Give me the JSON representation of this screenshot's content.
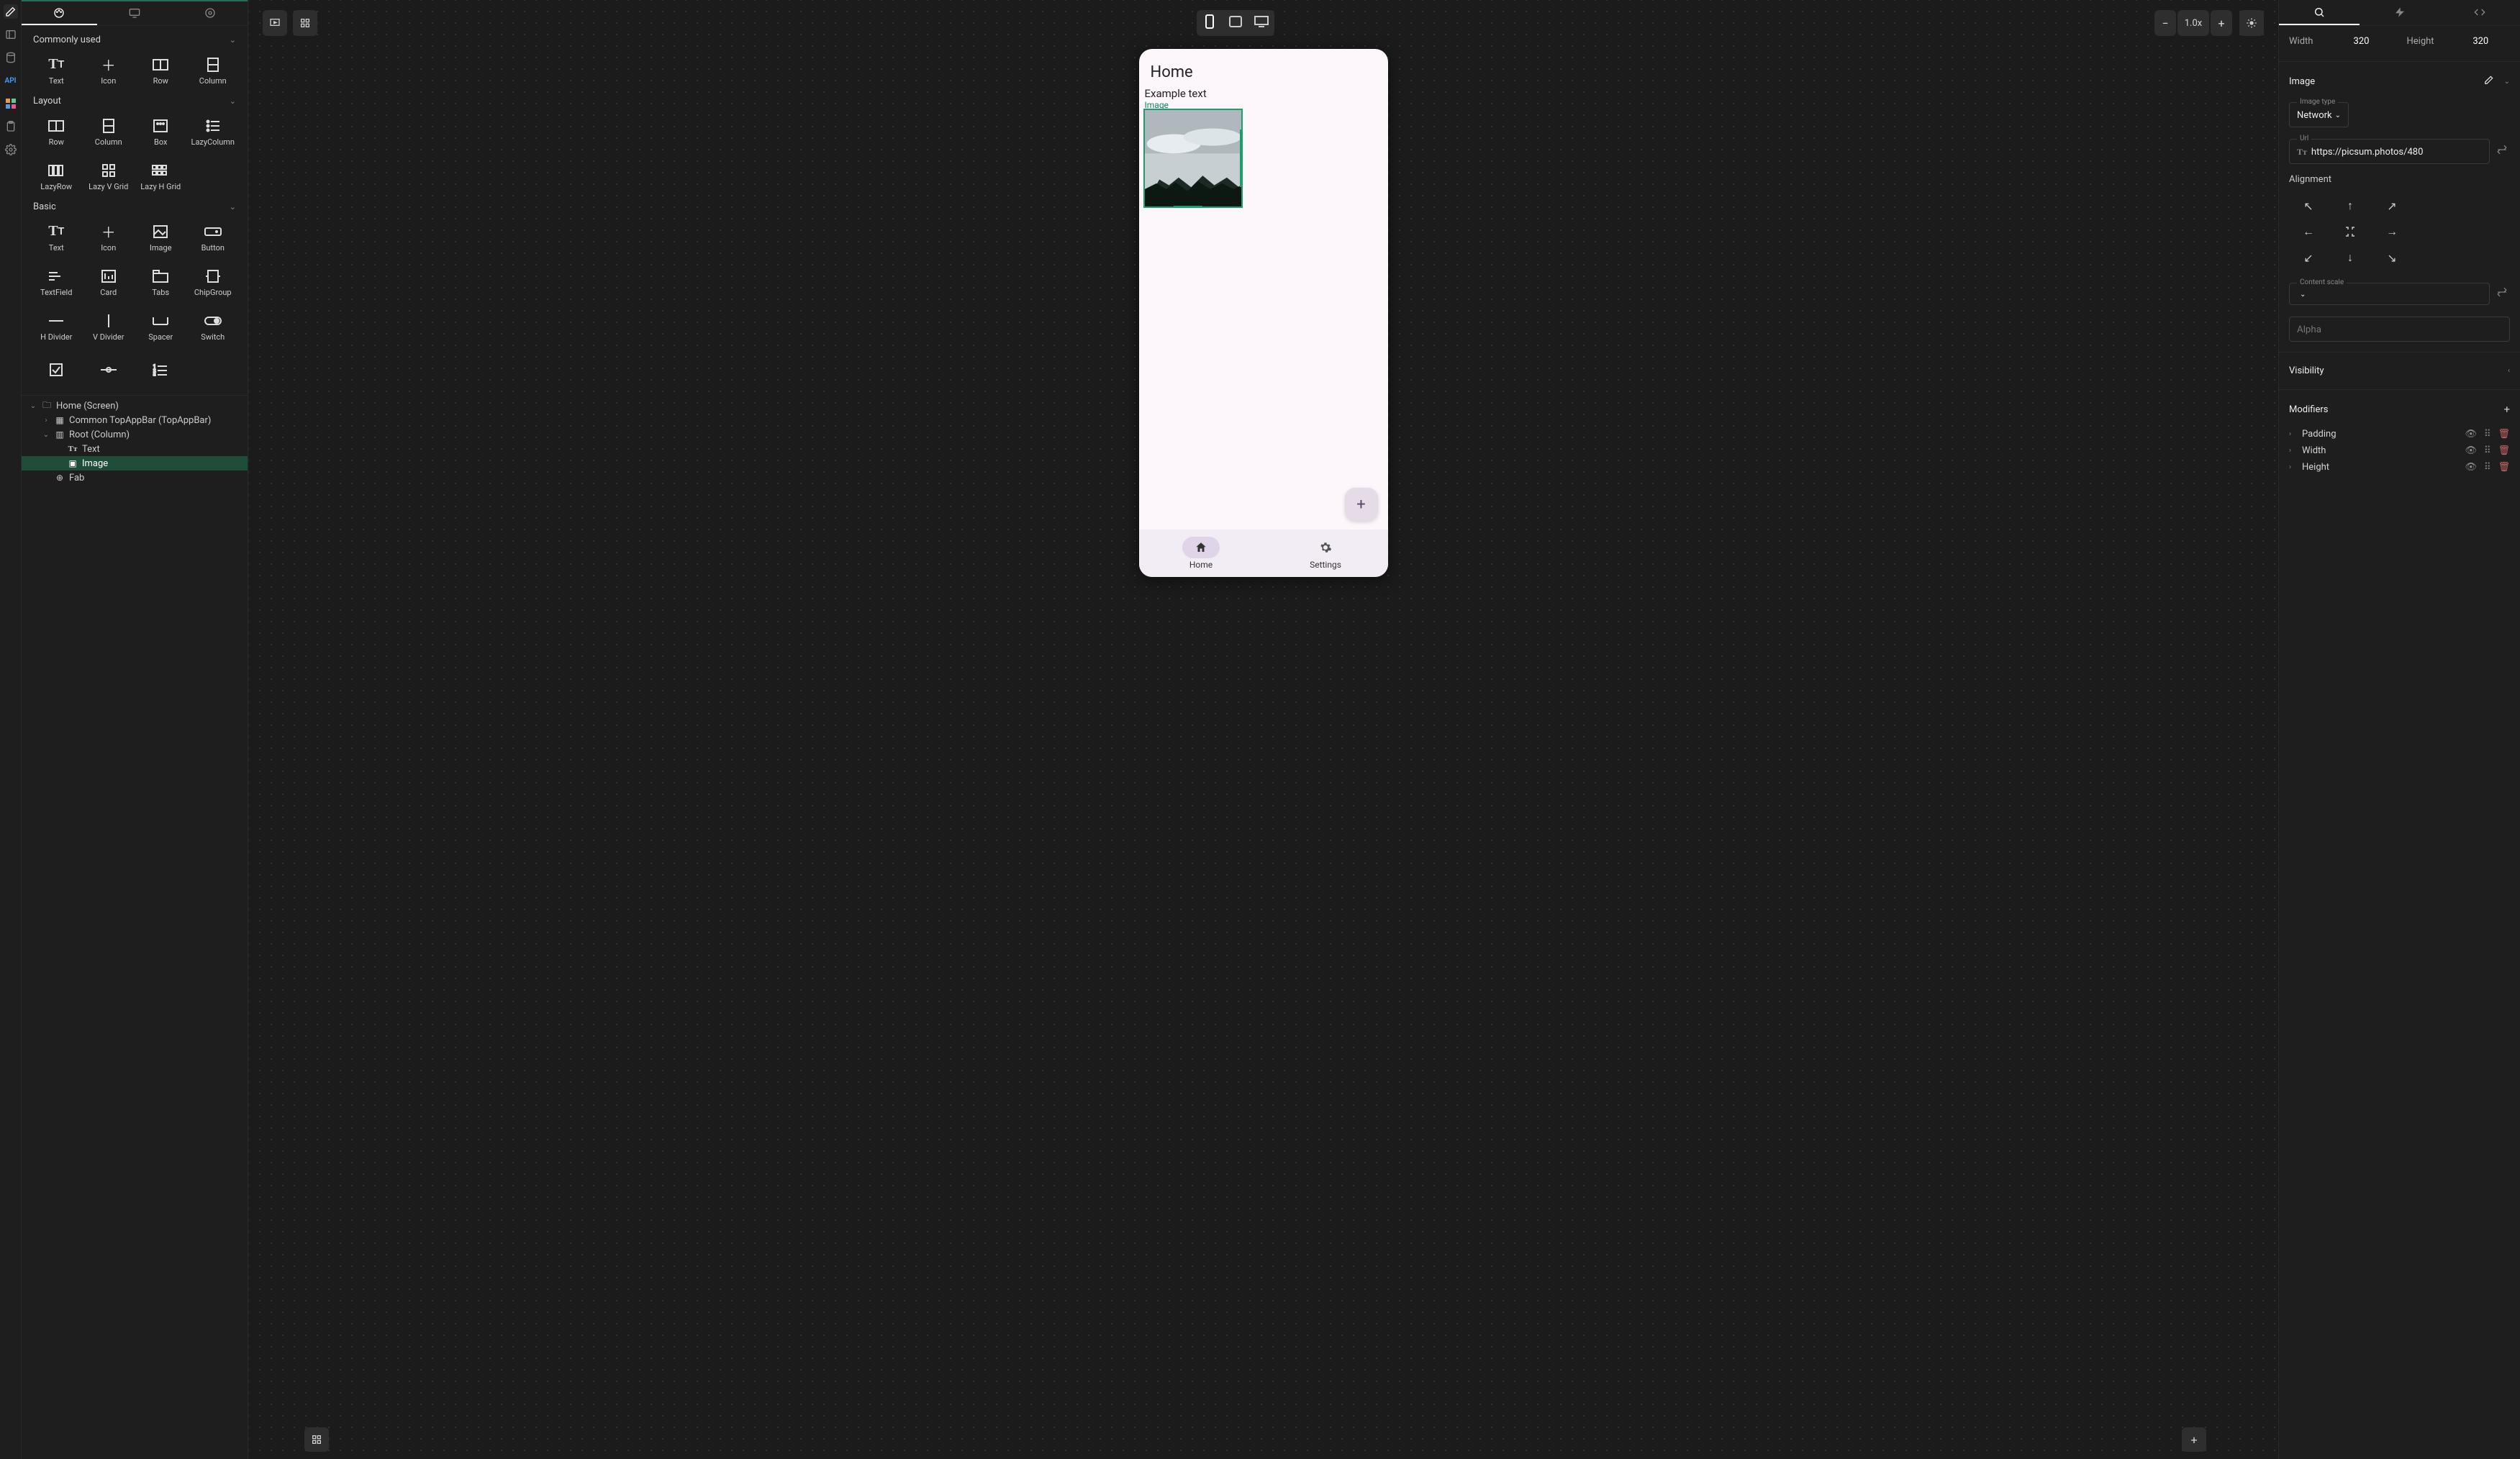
{
  "rail": {
    "icons": [
      "edit",
      "panel",
      "db",
      "api",
      "grid",
      "clipboard",
      "gear"
    ]
  },
  "leftTabs": [
    "palette",
    "display",
    "settings"
  ],
  "palette": {
    "sections": [
      {
        "title": "Commonly used",
        "items": [
          {
            "label": "Text",
            "icon": "text"
          },
          {
            "label": "Icon",
            "icon": "plus"
          },
          {
            "label": "Row",
            "icon": "row"
          },
          {
            "label": "Column",
            "icon": "column"
          }
        ]
      },
      {
        "title": "Layout",
        "items": [
          {
            "label": "Row",
            "icon": "row"
          },
          {
            "label": "Column",
            "icon": "column"
          },
          {
            "label": "Box",
            "icon": "box"
          },
          {
            "label": "LazyColumn",
            "icon": "list"
          },
          {
            "label": "LazyRow",
            "icon": "gridh"
          },
          {
            "label": "Lazy V Grid",
            "icon": "grid2"
          },
          {
            "label": "Lazy H Grid",
            "icon": "grid3"
          }
        ]
      },
      {
        "title": "Basic",
        "items": [
          {
            "label": "Text",
            "icon": "text"
          },
          {
            "label": "Icon",
            "icon": "plus"
          },
          {
            "label": "Image",
            "icon": "image"
          },
          {
            "label": "Button",
            "icon": "button"
          },
          {
            "label": "TextField",
            "icon": "textfield"
          },
          {
            "label": "Card",
            "icon": "card"
          },
          {
            "label": "Tabs",
            "icon": "tabs"
          },
          {
            "label": "ChipGroup",
            "icon": "chip"
          },
          {
            "label": "H Divider",
            "icon": "hdivider"
          },
          {
            "label": "V Divider",
            "icon": "vdivider"
          },
          {
            "label": "Spacer",
            "icon": "spacer"
          },
          {
            "label": "Switch",
            "icon": "switch"
          },
          {
            "label": "",
            "icon": "check"
          },
          {
            "label": "",
            "icon": "slider"
          },
          {
            "label": "",
            "icon": "numlist"
          }
        ]
      }
    ]
  },
  "tree": [
    {
      "depth": 0,
      "twist": "▾",
      "icon": "folder",
      "label": "Home (Screen)"
    },
    {
      "depth": 1,
      "twist": "▸",
      "icon": "grid",
      "label": "Common TopAppBar (TopAppBar)"
    },
    {
      "depth": 1,
      "twist": "▾",
      "icon": "column",
      "label": "Root (Column)"
    },
    {
      "depth": 2,
      "twist": "",
      "icon": "text",
      "label": "Text"
    },
    {
      "depth": 2,
      "twist": "",
      "icon": "image",
      "label": "Image",
      "selected": true
    },
    {
      "depth": 1,
      "twist": "",
      "icon": "plusCircle",
      "label": "Fab"
    }
  ],
  "toolbar": {
    "zoom": "1.0x",
    "devices": [
      "phone",
      "tablet",
      "desktop"
    ]
  },
  "phone": {
    "title": "Home",
    "subtitle": "Example text",
    "imageTag": "Image",
    "nav": [
      {
        "label": "Home",
        "icon": "home",
        "active": true
      },
      {
        "label": "Settings",
        "icon": "gear",
        "active": false
      }
    ]
  },
  "right": {
    "width": {
      "label": "Width",
      "value": "320"
    },
    "height": {
      "label": "Height",
      "value": "320"
    },
    "componentName": "Image",
    "imageType": {
      "legend": "Image type",
      "value": "Network"
    },
    "url": {
      "legend": "Url",
      "value": "https://picsum.photos/480"
    },
    "alignment": "Alignment",
    "contentScale": {
      "legend": "Content scale",
      "value": ""
    },
    "alpha": {
      "placeholder": "Alpha"
    },
    "visibility": "Visibility",
    "modifiers": {
      "title": "Modifiers",
      "items": [
        "Padding",
        "Width",
        "Height"
      ]
    }
  }
}
